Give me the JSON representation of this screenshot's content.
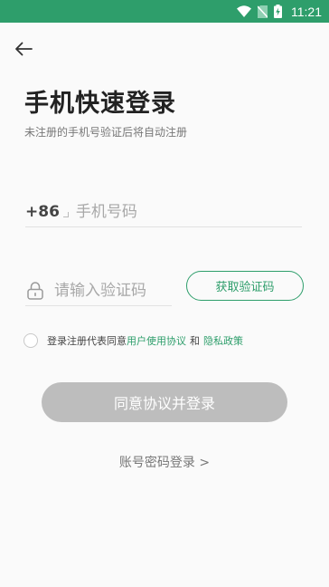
{
  "status_bar": {
    "time": "11:21",
    "icons": [
      "wifi-icon",
      "no-sim-icon",
      "battery-charging-icon"
    ],
    "background": "#2E9E6B"
  },
  "nav": {
    "back_icon": "arrow-left-icon"
  },
  "header": {
    "title": "手机快速登录",
    "subtitle": "未注册的手机号验证后将自动注册"
  },
  "phone": {
    "prefix": "+86",
    "placeholder": "手机号码",
    "value": ""
  },
  "code": {
    "icon": "lock-icon",
    "placeholder": "请输入验证码",
    "value": "",
    "get_code_label": "获取验证码"
  },
  "agreement": {
    "checked": false,
    "text": "登录注册代表同意",
    "user_agreement": "用户使用协议",
    "and": "和",
    "privacy_policy": "隐私政策"
  },
  "login_button": {
    "label": "同意协议并登录",
    "enabled": false
  },
  "alt_login": {
    "label": "账号密码登录 >"
  },
  "colors": {
    "accent": "#2E9E6B",
    "disabled_button": "#BDBDBD",
    "background": "#FAFAFA"
  }
}
